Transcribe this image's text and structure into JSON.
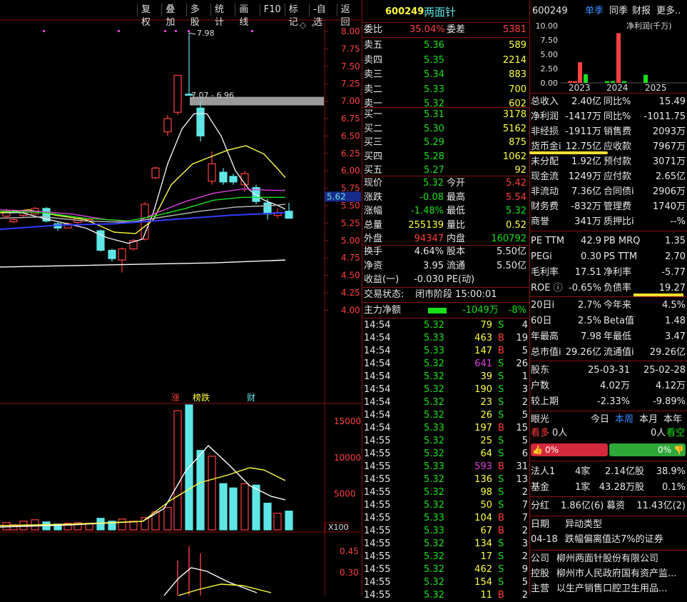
{
  "toolbar": [
    "复权",
    "叠加",
    "多股",
    "统计",
    "画线",
    "F10",
    "标记",
    "-自选",
    "返回"
  ],
  "chart": {
    "y_ticks": [
      "8.00",
      "7.75",
      "7.50",
      "7.25",
      "7.00",
      "6.75",
      "6.50",
      "6.25",
      "6.00",
      "5.75",
      "5.50",
      "5.25",
      "5.00",
      "4.75",
      "4.50",
      "4.25",
      "4.00"
    ],
    "high_label": "7.98",
    "range_label": "7.07 - 6.96",
    "price_tag": "5.62",
    "event_tags": [
      {
        "text": "涨",
        "color": "#ff4040"
      },
      {
        "text": "榜",
        "color": "#ffff40"
      },
      {
        "text": "跌",
        "color": "#ffff40"
      },
      {
        "text": "财",
        "color": "#5fe6e6"
      }
    ],
    "vol_ticks": [
      "15000",
      "10000",
      "5000"
    ],
    "vol_unit": "X100",
    "ind_ticks": [
      "0.45",
      "0.30"
    ]
  },
  "quote": {
    "code": "600249",
    "name": "两面针",
    "weibi_label": "委比",
    "weibi": "35.04%",
    "weicha_label": "委差",
    "weicha": "5381",
    "asks": [
      {
        "label": "卖五",
        "price": "5.36",
        "vol": "589"
      },
      {
        "label": "卖四",
        "price": "5.35",
        "vol": "2214"
      },
      {
        "label": "卖三",
        "price": "5.34",
        "vol": "883"
      },
      {
        "label": "卖二",
        "price": "5.33",
        "vol": "700"
      },
      {
        "label": "卖一",
        "price": "5.32",
        "vol": "602"
      }
    ],
    "bids": [
      {
        "label": "买一",
        "price": "5.31",
        "vol": "3178"
      },
      {
        "label": "买二",
        "price": "5.30",
        "vol": "5162"
      },
      {
        "label": "买三",
        "price": "5.29",
        "vol": "875"
      },
      {
        "label": "买四",
        "price": "5.28",
        "vol": "1062"
      },
      {
        "label": "买五",
        "price": "5.27",
        "vol": "92"
      }
    ],
    "stats": [
      {
        "l1": "现价",
        "v1": "5.32",
        "c1": "green",
        "l2": "今开",
        "v2": "5.42",
        "c2": "red"
      },
      {
        "l1": "涨跌",
        "v1": "-0.08",
        "c1": "green",
        "l2": "最高",
        "v2": "5.54",
        "c2": "red"
      },
      {
        "l1": "涨幅",
        "v1": "-1.48%",
        "c1": "green",
        "l2": "最低",
        "v2": "5.32",
        "c2": "green"
      },
      {
        "l1": "总量",
        "v1": "255139",
        "c1": "yellow",
        "l2": "量比",
        "v2": "0.52",
        "c2": "yellow"
      },
      {
        "l1": "外盘",
        "v1": "94347",
        "c1": "red",
        "l2": "内盘",
        "v2": "160792",
        "c2": "green"
      }
    ],
    "stats2": [
      {
        "l1": "换手",
        "v1": "4.64%",
        "l2": "股本",
        "v2": "5.50亿"
      },
      {
        "l1": "净资",
        "v1": "3.95",
        "l2": "流通",
        "v2": "5.50亿"
      },
      {
        "l1": "收益(一)",
        "v1": "-0.030",
        "l2": "PE(动)",
        "v2": ""
      }
    ],
    "trade_status_label": "交易状态:",
    "trade_status": "闭市阶段 15:00:01",
    "zhuli_label": "主力净额",
    "zhuli_value": "-1049万",
    "zhuli_pct": "-8%",
    "ticks": [
      {
        "t": "14:54",
        "p": "5.32",
        "v": "79",
        "d": "S",
        "n": "4",
        "pc": "green",
        "vc": "yellow"
      },
      {
        "t": "14:54",
        "p": "5.33",
        "v": "463",
        "d": "B",
        "n": "19",
        "pc": "green",
        "vc": "yellow"
      },
      {
        "t": "14:54",
        "p": "5.33",
        "v": "147",
        "d": "B",
        "n": "5",
        "pc": "green",
        "vc": "yellow"
      },
      {
        "t": "14:54",
        "p": "5.32",
        "v": "641",
        "d": "S",
        "n": "26",
        "pc": "green",
        "vc": "magenta"
      },
      {
        "t": "14:54",
        "p": "5.32",
        "v": "39",
        "d": "S",
        "n": "1",
        "pc": "green",
        "vc": "yellow"
      },
      {
        "t": "14:54",
        "p": "5.32",
        "v": "190",
        "d": "S",
        "n": "3",
        "pc": "green",
        "vc": "yellow"
      },
      {
        "t": "14:54",
        "p": "5.32",
        "v": "23",
        "d": "S",
        "n": "2",
        "pc": "green",
        "vc": "yellow"
      },
      {
        "t": "14:54",
        "p": "5.32",
        "v": "26",
        "d": "S",
        "n": "5",
        "pc": "green",
        "vc": "yellow"
      },
      {
        "t": "14:54",
        "p": "5.33",
        "v": "197",
        "d": "B",
        "n": "15",
        "pc": "green",
        "vc": "yellow"
      },
      {
        "t": "14:55",
        "p": "5.32",
        "v": "25",
        "d": "S",
        "n": "5",
        "pc": "green",
        "vc": "yellow"
      },
      {
        "t": "14:55",
        "p": "5.32",
        "v": "64",
        "d": "S",
        "n": "6",
        "pc": "green",
        "vc": "yellow"
      },
      {
        "t": "14:55",
        "p": "5.33",
        "v": "593",
        "d": "B",
        "n": "31",
        "pc": "green",
        "vc": "magenta"
      },
      {
        "t": "14:55",
        "p": "5.32",
        "v": "136",
        "d": "S",
        "n": "13",
        "pc": "green",
        "vc": "yellow"
      },
      {
        "t": "14:55",
        "p": "5.32",
        "v": "98",
        "d": "S",
        "n": "2",
        "pc": "green",
        "vc": "yellow"
      },
      {
        "t": "14:55",
        "p": "5.32",
        "v": "50",
        "d": "S",
        "n": "7",
        "pc": "green",
        "vc": "yellow"
      },
      {
        "t": "14:55",
        "p": "5.33",
        "v": "104",
        "d": "B",
        "n": "7",
        "pc": "green",
        "vc": "yellow"
      },
      {
        "t": "14:55",
        "p": "5.33",
        "v": "67",
        "d": "B",
        "n": "2",
        "pc": "green",
        "vc": "yellow"
      },
      {
        "t": "14:55",
        "p": "5.32",
        "v": "134",
        "d": "S",
        "n": "3",
        "pc": "green",
        "vc": "yellow"
      },
      {
        "t": "14:55",
        "p": "5.32",
        "v": "17",
        "d": "S",
        "n": "2",
        "pc": "green",
        "vc": "yellow"
      },
      {
        "t": "14:55",
        "p": "5.32",
        "v": "462",
        "d": "S",
        "n": "9",
        "pc": "green",
        "vc": "yellow"
      },
      {
        "t": "14:55",
        "p": "5.32",
        "v": "154",
        "d": "S",
        "n": "5",
        "pc": "green",
        "vc": "yellow"
      },
      {
        "t": "14:55",
        "p": "5.32",
        "v": "11",
        "d": "B",
        "n": "2",
        "pc": "green",
        "vc": "yellow"
      }
    ]
  },
  "f10": {
    "code": "600249",
    "tabs": [
      "单季",
      "同季",
      "财报",
      "更多.."
    ],
    "mini_chart_title": "净利润(千万)",
    "mini_y": [
      "10.00",
      "7.50",
      "5.00",
      "2.50",
      "0.00"
    ],
    "mini_x": [
      "2023",
      "2024",
      "2025"
    ],
    "fin": [
      {
        "l1": "总收入",
        "v1": "2.40亿",
        "l2": "同比%",
        "v2": "15.49"
      },
      {
        "l1": "净利润",
        "v1": "-1417万",
        "l2": "同比%",
        "v2": "-1011.75"
      },
      {
        "l1": "非经损",
        "v1": "-1911万",
        "l2": "销售费",
        "v2": "2093万"
      },
      {
        "l1": "货币金i",
        "v1": "12.75亿",
        "l2": "应收款",
        "v2": "7967万"
      },
      {
        "l1": "未分配",
        "v1": "1.92亿",
        "l2": "预付款",
        "v2": "3071万"
      },
      {
        "l1": "现金流",
        "v1": "1249万",
        "l2": "应付款",
        "v2": "2.65亿"
      },
      {
        "l1": "非流动",
        "v1": "7.36亿",
        "l2": "合同债i",
        "v2": "2906万"
      },
      {
        "l1": "财务费",
        "v1": "-832万",
        "l2": "管理费",
        "v2": "1740万"
      },
      {
        "l1": "商誉",
        "v1": "341万",
        "l2": "质押比i",
        "v2": "--%"
      }
    ],
    "val": [
      {
        "l1": "PE TTM",
        "v1": "42.9",
        "l2": "PB MRQ",
        "v2": "1.35"
      },
      {
        "l1": "PEGi",
        "v1": "0.30",
        "l2": "PS TTM",
        "v2": "2.70"
      },
      {
        "l1": "毛利率",
        "v1": "17.51",
        "l2": "净利率",
        "v2": "-5.77"
      },
      {
        "l1": "ROE ⓘ",
        "v1": "-0.65%",
        "l2": "负债率",
        "v2": "19.27"
      }
    ],
    "perf": [
      {
        "l1": "20日i",
        "v1": "2.7%",
        "l2": "今年来",
        "v2": "4.5%"
      },
      {
        "l1": "60日",
        "v1": "2.5%",
        "l2": "Beta值",
        "v2": "1.48"
      },
      {
        "l1": "年最高",
        "v1": "7.98",
        "l2": "年最低",
        "v2": "3.47"
      },
      {
        "l1": "总市值i",
        "v1": "29.26亿",
        "l2": "流通值i",
        "v2": "29.26亿"
      }
    ],
    "holders": [
      {
        "l": "股东",
        "a": "25-03-31",
        "b": "25-02-28"
      },
      {
        "l": "户数",
        "a": "4.02万",
        "b": "4.12万"
      },
      {
        "l": "较上期",
        "a": "-2.33%",
        "b": "-9.89%"
      }
    ],
    "yanguang": {
      "label": "眼光",
      "tabs": [
        "今日",
        "本周",
        "本月",
        "本年"
      ],
      "kanduo": "看多",
      "kanduo_n": "0人",
      "kankong": "看空",
      "kankong_n": "0人",
      "bull_pct": "0%",
      "bear_pct": "0%"
    },
    "inst": [
      {
        "l": "法人1",
        "a": "4家",
        "b": "2.14亿股",
        "c": "38.9%"
      },
      {
        "l": "基金",
        "a": "1家",
        "b": "43.28万股",
        "c": "0.1%"
      }
    ],
    "dividend": {
      "l": "分红",
      "v": "1.86亿(6)",
      "l2": "募资",
      "v2": "11.43亿(2)"
    },
    "abnormal": {
      "l": "日期",
      "v": "异动类型",
      "date": "04-18",
      "desc": "跌幅偏离值达7%的证券"
    },
    "company": [
      {
        "l": "公司",
        "v": "柳州两面针股份有限公司"
      },
      {
        "l": "控股",
        "v": "柳州市人民政府国有资产监..."
      },
      {
        "l": "主营",
        "v": "以生产销售口腔卫生用品..."
      }
    ]
  }
}
